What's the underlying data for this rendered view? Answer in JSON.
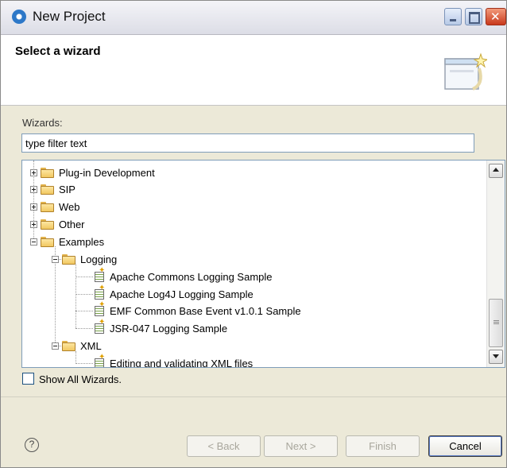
{
  "window": {
    "title": "New Project",
    "header_title": "Select a wizard"
  },
  "wizards_label": "Wizards:",
  "filter": {
    "value": "type filter text",
    "placeholder": "type filter text"
  },
  "tree": {
    "plugin_development": "Plug-in Development",
    "sip": "SIP",
    "web": "Web",
    "other": "Other",
    "examples": "Examples",
    "logging": "Logging",
    "apache_commons": "Apache Commons Logging Sample",
    "apache_log4j": "Apache Log4J Logging Sample",
    "emf_cbe": "EMF Common Base Event v1.0.1 Sample",
    "jsr047": "JSR-047 Logging Sample",
    "xml": "XML",
    "editing_xml": "Editing and validating XML files"
  },
  "show_all": {
    "label": "Show All Wizards.",
    "checked": false
  },
  "buttons": {
    "help": "?",
    "back": "< Back",
    "next": "Next >",
    "finish": "Finish",
    "cancel": "Cancel"
  }
}
